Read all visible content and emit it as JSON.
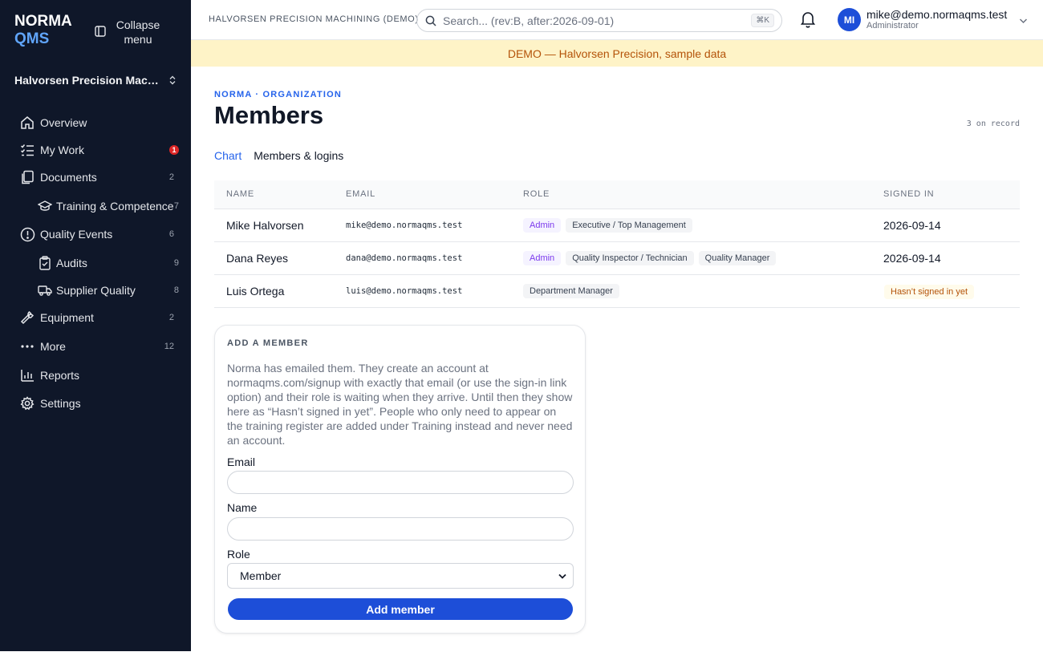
{
  "brand": {
    "line1": "NORMA",
    "line2": "QMS"
  },
  "sidebar": {
    "collapse_label": "Collapse menu",
    "org_name": "Halvorsen Precision Machi...",
    "items": [
      {
        "label": "Overview",
        "count": ""
      },
      {
        "label": "My Work",
        "count": "1"
      },
      {
        "label": "Documents",
        "count": "2"
      },
      {
        "label": "Training & Competence",
        "count": "7"
      },
      {
        "label": "Quality Events",
        "count": "6"
      },
      {
        "label": "Audits",
        "count": "9"
      },
      {
        "label": "Supplier Quality",
        "count": "8"
      },
      {
        "label": "Equipment",
        "count": "2"
      },
      {
        "label": "More",
        "count": "12"
      },
      {
        "label": "Reports",
        "count": ""
      },
      {
        "label": "Settings",
        "count": ""
      }
    ]
  },
  "topbar": {
    "company": "HALVORSEN PRECISION MACHINING (DEMO)",
    "search_placeholder": "Search... (rev:B, after:2026-09-01)",
    "search_shortcut": "⌘K",
    "user_initials": "MI",
    "user_email": "mike@demo.normaqms.test",
    "user_role": "Administrator"
  },
  "banner": "DEMO — Halvorsen Precision, sample data",
  "page": {
    "eyebrow": "NORMA · ORGANIZATION",
    "title": "Members",
    "record_count": "3 on record",
    "tabs": {
      "chart": "Chart",
      "members": "Members & logins"
    }
  },
  "table": {
    "headers": {
      "name": "NAME",
      "email": "EMAIL",
      "role": "ROLE",
      "signed": "SIGNED IN"
    },
    "rows": [
      {
        "name": "Mike Halvorsen",
        "email": "mike@demo.normaqms.test",
        "roles": [
          "Admin",
          "Executive / Top Management"
        ],
        "signed": "2026-09-14"
      },
      {
        "name": "Dana Reyes",
        "email": "dana@demo.normaqms.test",
        "roles": [
          "Admin",
          "Quality Inspector / Technician",
          "Quality Manager"
        ],
        "signed": "2026-09-14"
      },
      {
        "name": "Luis Ortega",
        "email": "luis@demo.normaqms.test",
        "roles": [
          "Department Manager"
        ],
        "signed": "Hasn’t signed in yet"
      }
    ]
  },
  "add_member": {
    "title": "ADD A MEMBER",
    "description": "Norma has emailed them. They create an account at normaqms.com/signup with exactly that email (or use the sign-in link option) and their role is waiting when they arrive. Until then they show here as “Hasn’t signed in yet”. People who only need to appear on the training register are added under Training instead and never need an account.",
    "email_label": "Email",
    "email_value": "",
    "name_label": "Name",
    "name_value": "",
    "role_label": "Role",
    "role_selected": "Member",
    "submit_label": "Add member"
  },
  "colors": {
    "sidebar_bg": "#0f1729",
    "accent": "#1d4ed8",
    "banner_bg": "#fef3c7",
    "badge_red": "#dc2626"
  }
}
